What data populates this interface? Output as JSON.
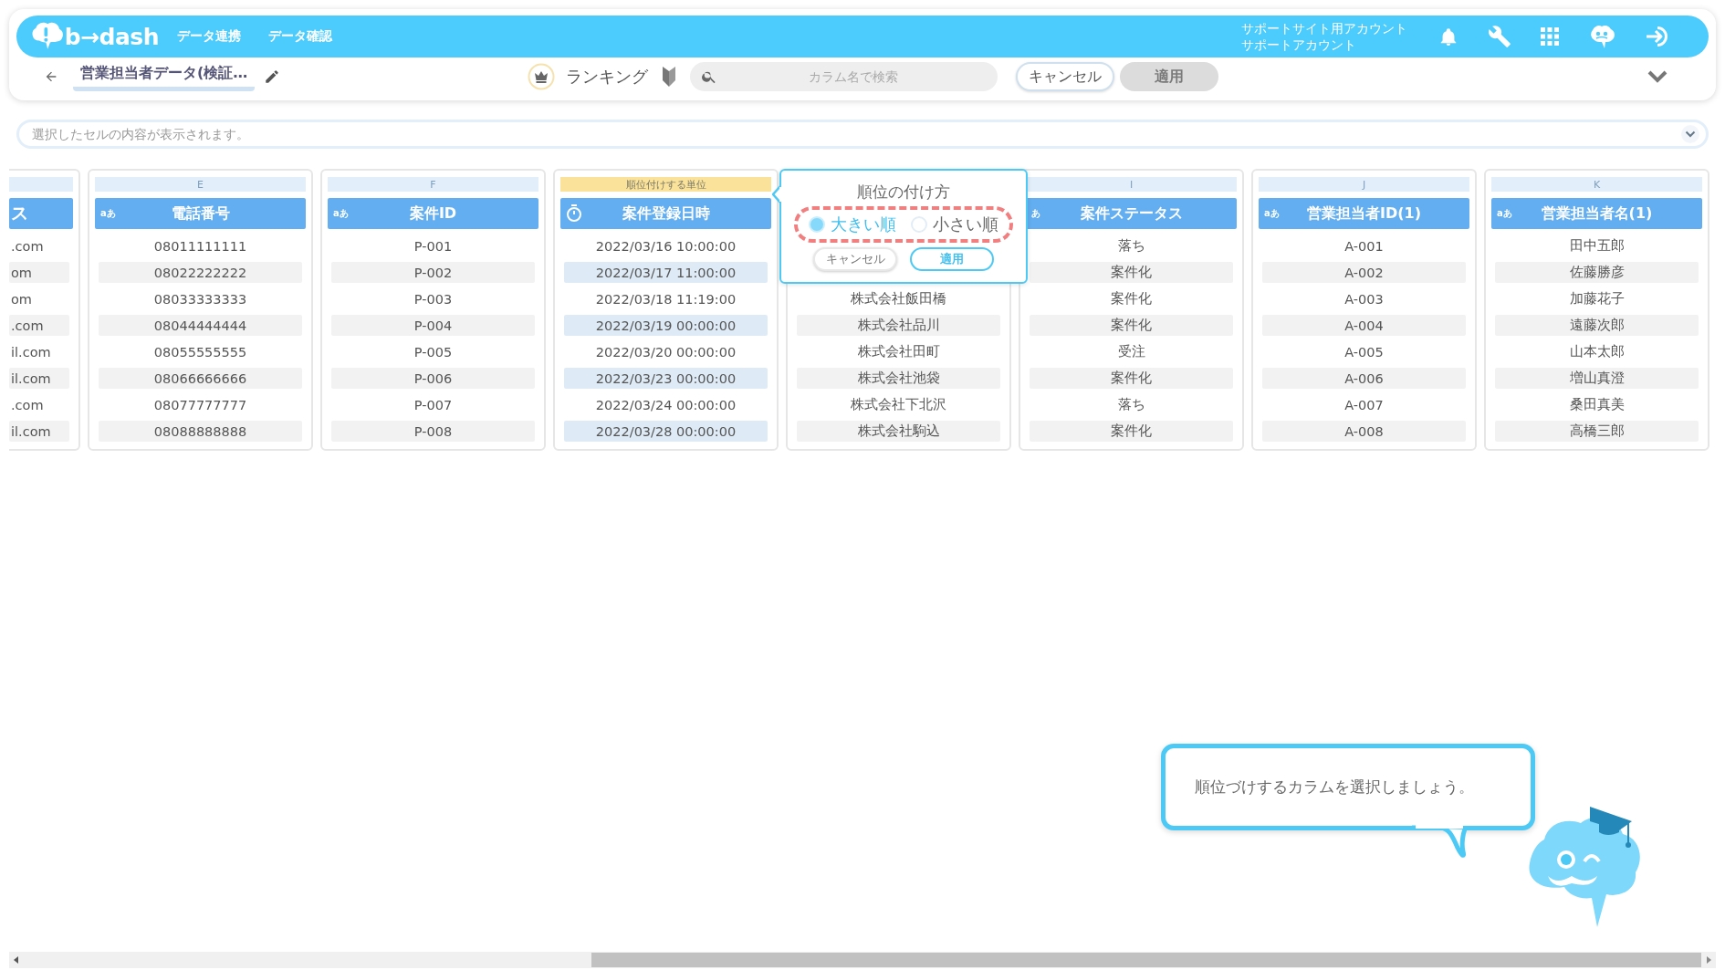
{
  "header": {
    "logo_text": "b→dash",
    "nav": [
      "データ連携",
      "データ確認"
    ],
    "account": [
      "サポートサイト用アカウント",
      "サポートアカウント"
    ]
  },
  "toolbar": {
    "title": "営業担当者データ(検証…",
    "mode": "ランキング",
    "search": {
      "placeholder": "カラム名で検索"
    },
    "buttons": [
      {
        "label": "キャンセル",
        "kind": "cancel",
        "disabled": false
      },
      {
        "label": "適用",
        "kind": "apply",
        "disabled": true
      }
    ]
  },
  "cell_bar": {
    "placeholder": "選択したセルの内容が表示されます。"
  },
  "columns": [
    {
      "clipped": true,
      "selected": false,
      "header": "ス",
      "rows": [
        ".com",
        "om",
        "om",
        ".com",
        "il.com",
        "il.com",
        ".com",
        "il.com"
      ]
    },
    {
      "clipped": false,
      "selected": false,
      "top_label": "E",
      "kind": "text",
      "type_label": "aあ",
      "header": "電話番号",
      "rows": [
        "08011111111",
        "08022222222",
        "08033333333",
        "08044444444",
        "08055555555",
        "08066666666",
        "08077777777",
        "08088888888"
      ]
    },
    {
      "clipped": false,
      "selected": false,
      "top_label": "F",
      "kind": "text",
      "type_label": "aあ",
      "header": "案件ID",
      "rows": [
        "P-001",
        "P-002",
        "P-003",
        "P-004",
        "P-005",
        "P-006",
        "P-007",
        "P-008"
      ]
    },
    {
      "clipped": false,
      "selected": true,
      "top_label": "順位付けする単位",
      "kind": "datetime",
      "header": "案件登録日時",
      "rows": [
        "2022/03/16 10:00:00",
        "2022/03/17 11:00:00",
        "2022/03/18 11:19:00",
        "2022/03/19 00:00:00",
        "2022/03/20 00:00:00",
        "2022/03/23 00:00:00",
        "2022/03/24 00:00:00",
        "2022/03/28 00:00:00"
      ]
    },
    {
      "clipped": false,
      "selected": false,
      "rows": [
        "株式会社飯田橋",
        "株式会社品川",
        "株式会社田町",
        "株式会社池袋",
        "株式会社下北沢",
        "株式会社駒込"
      ]
    },
    {
      "clipped": false,
      "selected": false,
      "top_label": "I",
      "kind": "text",
      "type_label": "あ",
      "header": "案件ステータス",
      "rows": [
        "落ち",
        "案件化",
        "案件化",
        "案件化",
        "受注",
        "案件化",
        "落ち",
        "案件化"
      ]
    },
    {
      "clipped": false,
      "selected": false,
      "top_label": "J",
      "kind": "text",
      "type_label": "aあ",
      "header": "営業担当者ID(1)",
      "rows": [
        "A-001",
        "A-002",
        "A-003",
        "A-004",
        "A-005",
        "A-006",
        "A-007",
        "A-008"
      ]
    },
    {
      "clipped": false,
      "selected": false,
      "top_label": "K",
      "kind": "text",
      "type_label": "aあ",
      "header": "営業担当者名(1)",
      "rows": [
        "田中五郎",
        "佐藤勝彦",
        "加藤花子",
        "遠藤次郎",
        "山本太郎",
        "増山真澄",
        "桑田真美",
        "高橋三郎"
      ]
    }
  ],
  "popover": {
    "title": "順位の付け方",
    "options": [
      {
        "label": "大きい順",
        "selected": true
      },
      {
        "label": "小さい順",
        "selected": false
      }
    ],
    "buttons": [
      {
        "label": "キャンセル",
        "kind": "cancel"
      },
      {
        "label": "適用",
        "kind": "apply"
      }
    ]
  },
  "hint": "順位づけするカラムを選択しましょう。"
}
